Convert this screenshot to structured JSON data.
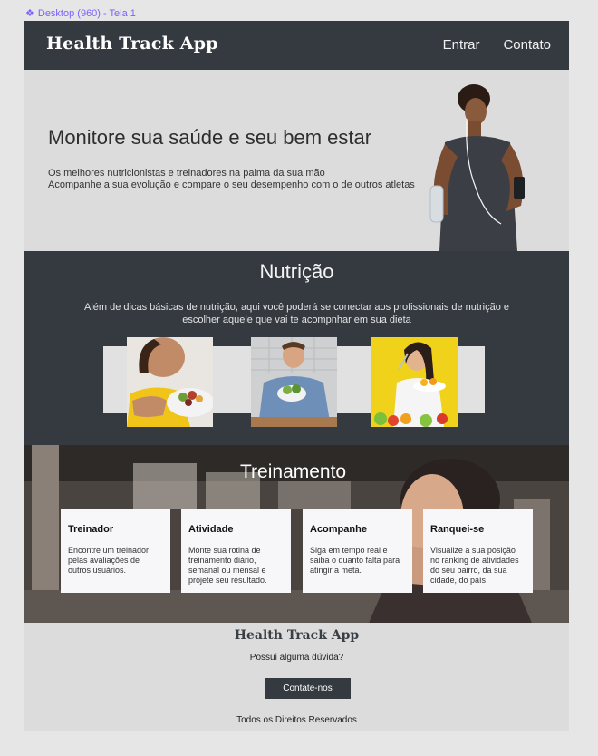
{
  "frame": {
    "label": "Desktop (960) - Tela 1",
    "icon": "component-icon"
  },
  "header": {
    "brand": "Health Track App",
    "nav": [
      "Entrar",
      "Contato"
    ]
  },
  "hero": {
    "title": "Monitore sua saúde e seu bem estar",
    "lines": [
      "Os melhores nutricionistas e treinadores na palma da sua mão",
      "Acompanhe a sua evolução e compare o seu desempenho com o de outros atletas"
    ],
    "image": "runner-photo"
  },
  "nutrition": {
    "title": "Nutrição",
    "description": "Além de dicas básicas de nutrição, aqui você poderá se conectar aos profissionais de nutrição e escolher aquele que vai te acompnhar em sua dieta",
    "photos": [
      "woman-eating-salad-photo",
      "man-eating-salad-photo",
      "woman-eating-fruit-photo"
    ]
  },
  "training": {
    "title": "Treinamento",
    "cards": [
      {
        "title": "Treinador",
        "text": "Encontre um treinador pelas avaliações de outros usuários."
      },
      {
        "title": "Atividade",
        "text": "Monte sua rotina de treinamento diário, semanal ou mensal e projete seu resultado."
      },
      {
        "title": "Acompanhe",
        "text": "Siga em tempo real e saiba o quanto falta para atingir a meta."
      },
      {
        "title": "Ranquei-se",
        "text": "Visualize a sua posição no ranking de atividades do seu bairro, da sua cidade, do país"
      }
    ]
  },
  "footer": {
    "brand": "Health Track App",
    "question": "Possui alguma dúvida?",
    "button": "Contate-nos",
    "copyright": "Todos os Direitos Reservados"
  },
  "colors": {
    "dark": "#343a40",
    "light": "#dcdcdc",
    "accent": "#7b61ff",
    "card": "#f7f7f9"
  }
}
